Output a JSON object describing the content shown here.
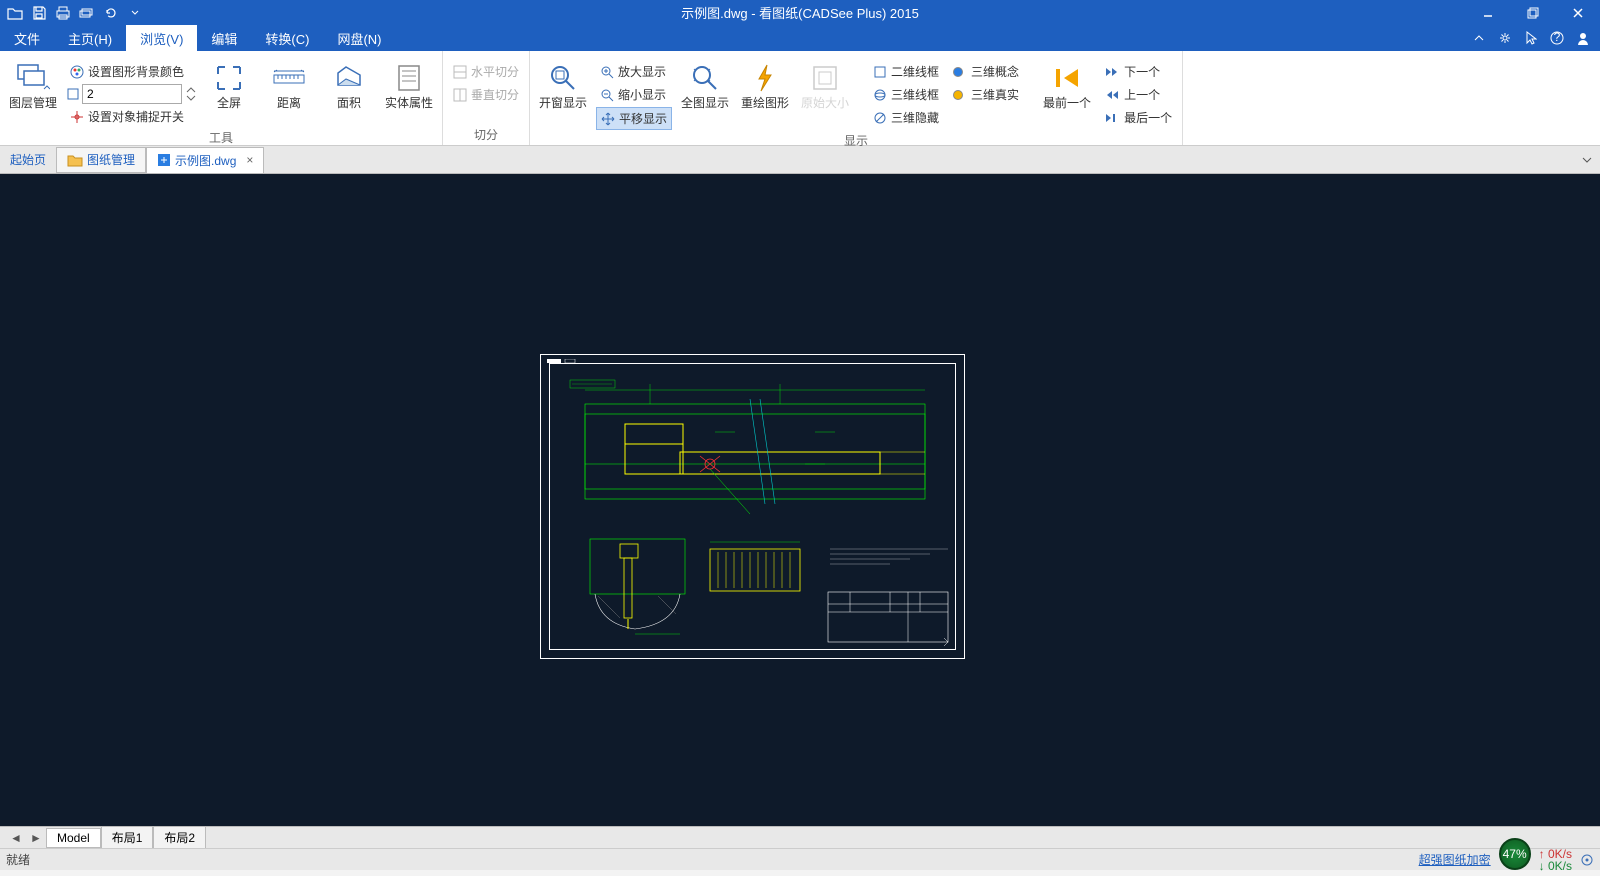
{
  "title": "示例图.dwg - 看图纸(CADSee Plus) 2015",
  "menu": {
    "file": "文件",
    "home": "主页(H)",
    "view": "浏览(V)",
    "edit": "编辑",
    "convert": "转换(C)",
    "cloud": "网盘(N)"
  },
  "ribbon": {
    "group_tools": "工具",
    "group_split": "切分",
    "group_display": "显示",
    "layer_mgr": "图层管理",
    "bg_color": "设置图形背景颜色",
    "spinner_val": "2",
    "snap_toggle": "设置对象捕捉开关",
    "fullscreen": "全屏",
    "distance": "距离",
    "area": "面积",
    "entity_props": "实体属性",
    "hsplit": "水平切分",
    "vsplit": "垂直切分",
    "zoom_window": "开窗显示",
    "zoom_in": "放大显示",
    "zoom_out": "缩小显示",
    "pan": "平移显示",
    "zoom_all": "全图显示",
    "redraw": "重绘图形",
    "orig_size": "原始大小",
    "wf2d": "二维线框",
    "wf3d": "三维线框",
    "hide3d": "三维隐藏",
    "concept3d": "三维概念",
    "real3d": "三维真实",
    "prev_one": "最前一个",
    "next": "下一个",
    "prev": "上一个",
    "last": "最后一个"
  },
  "doctabs": {
    "start": "起始页",
    "folder": "图纸管理",
    "file": "示例图.dwg"
  },
  "bottabs": {
    "model": "Model",
    "layout1": "布局1",
    "layout2": "布局2"
  },
  "status": {
    "ready": "就绪",
    "link": "超强图纸加密",
    "gauge": "47%",
    "up": "0K/s",
    "dn": "0K/s"
  }
}
